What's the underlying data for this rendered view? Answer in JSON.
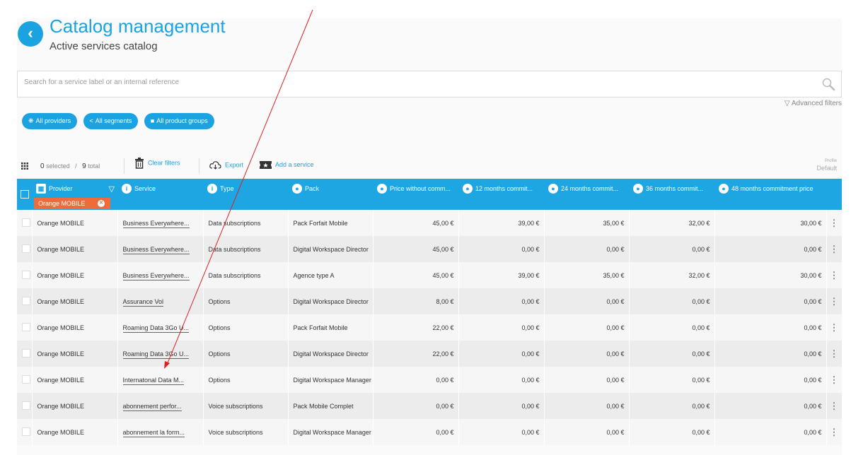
{
  "header": {
    "title": "Catalog management",
    "subtitle": "Active services catalog"
  },
  "search": {
    "placeholder": "Search for a service label or an internal reference"
  },
  "advanced_filters_label": "Advanced filters",
  "filter_pills": [
    {
      "label": "All providers",
      "icon": "network-icon"
    },
    {
      "label": "All segments",
      "icon": "share-icon"
    },
    {
      "label": "All product groups",
      "icon": "folder-icon"
    }
  ],
  "toolbar": {
    "selected_count": "0",
    "selected_label": "selected",
    "separator": "/",
    "total_count": "9",
    "total_label": "total",
    "clear_filters": "Clear filters",
    "export": "Export",
    "add_service": "Add a service",
    "profile_label": "Profile",
    "profile_value": "Default"
  },
  "table": {
    "columns": [
      "Provider",
      "Service",
      "Type",
      "Pack",
      "Price without comm...",
      "12 months commit...",
      "24 months commit...",
      "36 months commit...",
      "48 months commitment price"
    ],
    "provider_filter_tag": "Orange MOBILE",
    "rows": [
      [
        "Orange MOBILE",
        "Business Everywhere...",
        "Data subscriptions",
        "Pack Forfait Mobile",
        "45,00 €",
        "39,00 €",
        "35,00 €",
        "32,00 €",
        "30,00 €"
      ],
      [
        "Orange MOBILE",
        "Business Everywhere...",
        "Data subscriptions",
        "Digital Workspace Director",
        "45,00 €",
        "0,00 €",
        "0,00 €",
        "0,00 €",
        "0,00 €"
      ],
      [
        "Orange MOBILE",
        "Business Everywhere...",
        "Data subscriptions",
        "Agence type A",
        "45,00 €",
        "39,00 €",
        "35,00 €",
        "32,00 €",
        "30,00 €"
      ],
      [
        "Orange MOBILE",
        "Assurance Vol",
        "Options",
        "Digital Workspace Director",
        "8,00 €",
        "0,00 €",
        "0,00 €",
        "0,00 €",
        "0,00 €"
      ],
      [
        "Orange MOBILE",
        "Roaming Data 3Go U...",
        "Options",
        "Pack Forfait Mobile",
        "22,00 €",
        "0,00 €",
        "0,00 €",
        "0,00 €",
        "0,00 €"
      ],
      [
        "Orange MOBILE",
        "Roaming Data 3Go U...",
        "Options",
        "Digital Workspace Director",
        "22,00 €",
        "0,00 €",
        "0,00 €",
        "0,00 €",
        "0,00 €"
      ],
      [
        "Orange MOBILE",
        "Internatonal Data M...",
        "Options",
        "Digital Workspace Manager",
        "0,00 €",
        "0,00 €",
        "0,00 €",
        "0,00 €",
        "0,00 €"
      ],
      [
        "Orange MOBILE",
        "abonnement perfor...",
        "Voice subscriptions",
        "Pack Mobile Complet",
        "0,00 €",
        "0,00 €",
        "0,00 €",
        "0,00 €",
        "0,00 €"
      ],
      [
        "Orange MOBILE",
        "abonnement la form...",
        "Voice subscriptions",
        "Digital Workspace Manager",
        "0,00 €",
        "0,00 €",
        "0,00 €",
        "0,00 €",
        "0,00 €"
      ]
    ]
  },
  "colors": {
    "accent": "#1aa3e0",
    "header_bg": "#1ea6e2",
    "filter_tag": "#ef6b3c",
    "annotation_arrow": "#e02020"
  }
}
